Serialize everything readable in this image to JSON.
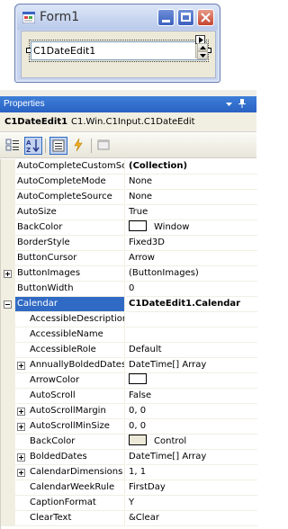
{
  "form": {
    "title": "Form1"
  },
  "control": {
    "text": "C1DateEdit1"
  },
  "properties_panel": {
    "title": "Properties",
    "object_name": "C1DateEdit1",
    "object_type": "C1.Win.C1Input.C1DateEdit",
    "toolbar": [
      "categorized-icon",
      "alphabetical-icon",
      "properties-icon",
      "events-icon",
      "property-pages-icon"
    ]
  },
  "colors": {
    "header_blue": "#316ac5",
    "window_swatch": "#ffffff",
    "control_swatch": "#ece9d8",
    "arrowcolor_swatch": "#ffffff"
  },
  "rows": [
    {
      "name": "AutoCompleteCustomSource",
      "value": "(Collection)",
      "bold": true
    },
    {
      "name": "AutoCompleteMode",
      "value": "None"
    },
    {
      "name": "AutoCompleteSource",
      "value": "None"
    },
    {
      "name": "AutoSize",
      "value": "True"
    },
    {
      "name": "BackColor",
      "value": "Window",
      "swatch": "window_swatch"
    },
    {
      "name": "BorderStyle",
      "value": "Fixed3D"
    },
    {
      "name": "ButtonCursor",
      "value": "Arrow"
    },
    {
      "name": "ButtonImages",
      "value": "(ButtonImages)",
      "expander": "plus"
    },
    {
      "name": "ButtonWidth",
      "value": "0"
    },
    {
      "name": "Calendar",
      "value": "C1DateEdit1.Calendar",
      "bold": true,
      "expander": "minus",
      "selected": true
    },
    {
      "name": "AccessibleDescription",
      "value": "",
      "sub": true
    },
    {
      "name": "AccessibleName",
      "value": "",
      "sub": true
    },
    {
      "name": "AccessibleRole",
      "value": "Default",
      "sub": true
    },
    {
      "name": "AnnuallyBoldedDates",
      "value": "DateTime[] Array",
      "sub": true,
      "expander": "plus"
    },
    {
      "name": "ArrowColor",
      "value": "",
      "sub": true,
      "swatch": "arrowcolor_swatch"
    },
    {
      "name": "AutoScroll",
      "value": "False",
      "sub": true
    },
    {
      "name": "AutoScrollMargin",
      "value": "0, 0",
      "sub": true,
      "expander": "plus"
    },
    {
      "name": "AutoScrollMinSize",
      "value": "0, 0",
      "sub": true,
      "expander": "plus"
    },
    {
      "name": "BackColor",
      "value": "Control",
      "sub": true,
      "swatch": "control_swatch"
    },
    {
      "name": "BoldedDates",
      "value": "DateTime[] Array",
      "sub": true,
      "expander": "plus"
    },
    {
      "name": "CalendarDimensions",
      "value": "1, 1",
      "sub": true,
      "expander": "plus"
    },
    {
      "name": "CalendarWeekRule",
      "value": "FirstDay",
      "sub": true
    },
    {
      "name": "CaptionFormat",
      "value": "Y",
      "sub": true
    },
    {
      "name": "ClearText",
      "value": "&Clear",
      "sub": true
    }
  ]
}
